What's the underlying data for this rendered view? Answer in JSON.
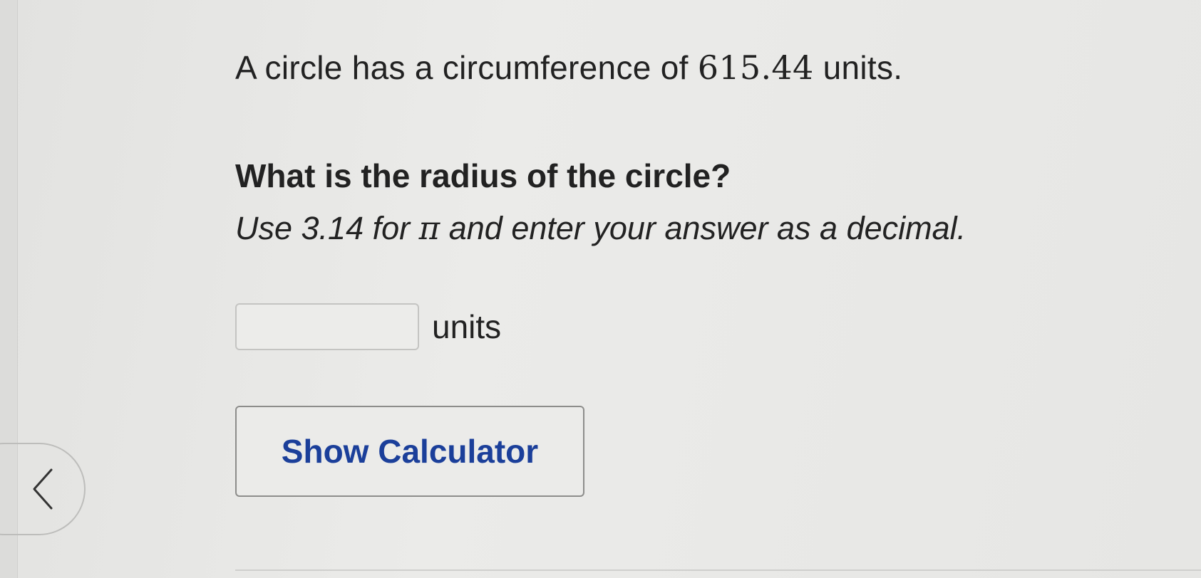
{
  "problem": {
    "statement_prefix": "A circle has a circumference of",
    "circumference_value": "615.44",
    "statement_suffix": "units.",
    "question": "What is the radius of the circle?",
    "instruction_prefix": "Use 3.14 for",
    "pi_symbol": "π",
    "instruction_suffix": "and enter your answer as a decimal."
  },
  "answer": {
    "value": "",
    "unit_label": "units"
  },
  "calculator": {
    "button_label": "Show Calculator",
    "accent_color": "#1b3f9a"
  },
  "navigation": {
    "prev_icon": "chevron-left-icon"
  }
}
